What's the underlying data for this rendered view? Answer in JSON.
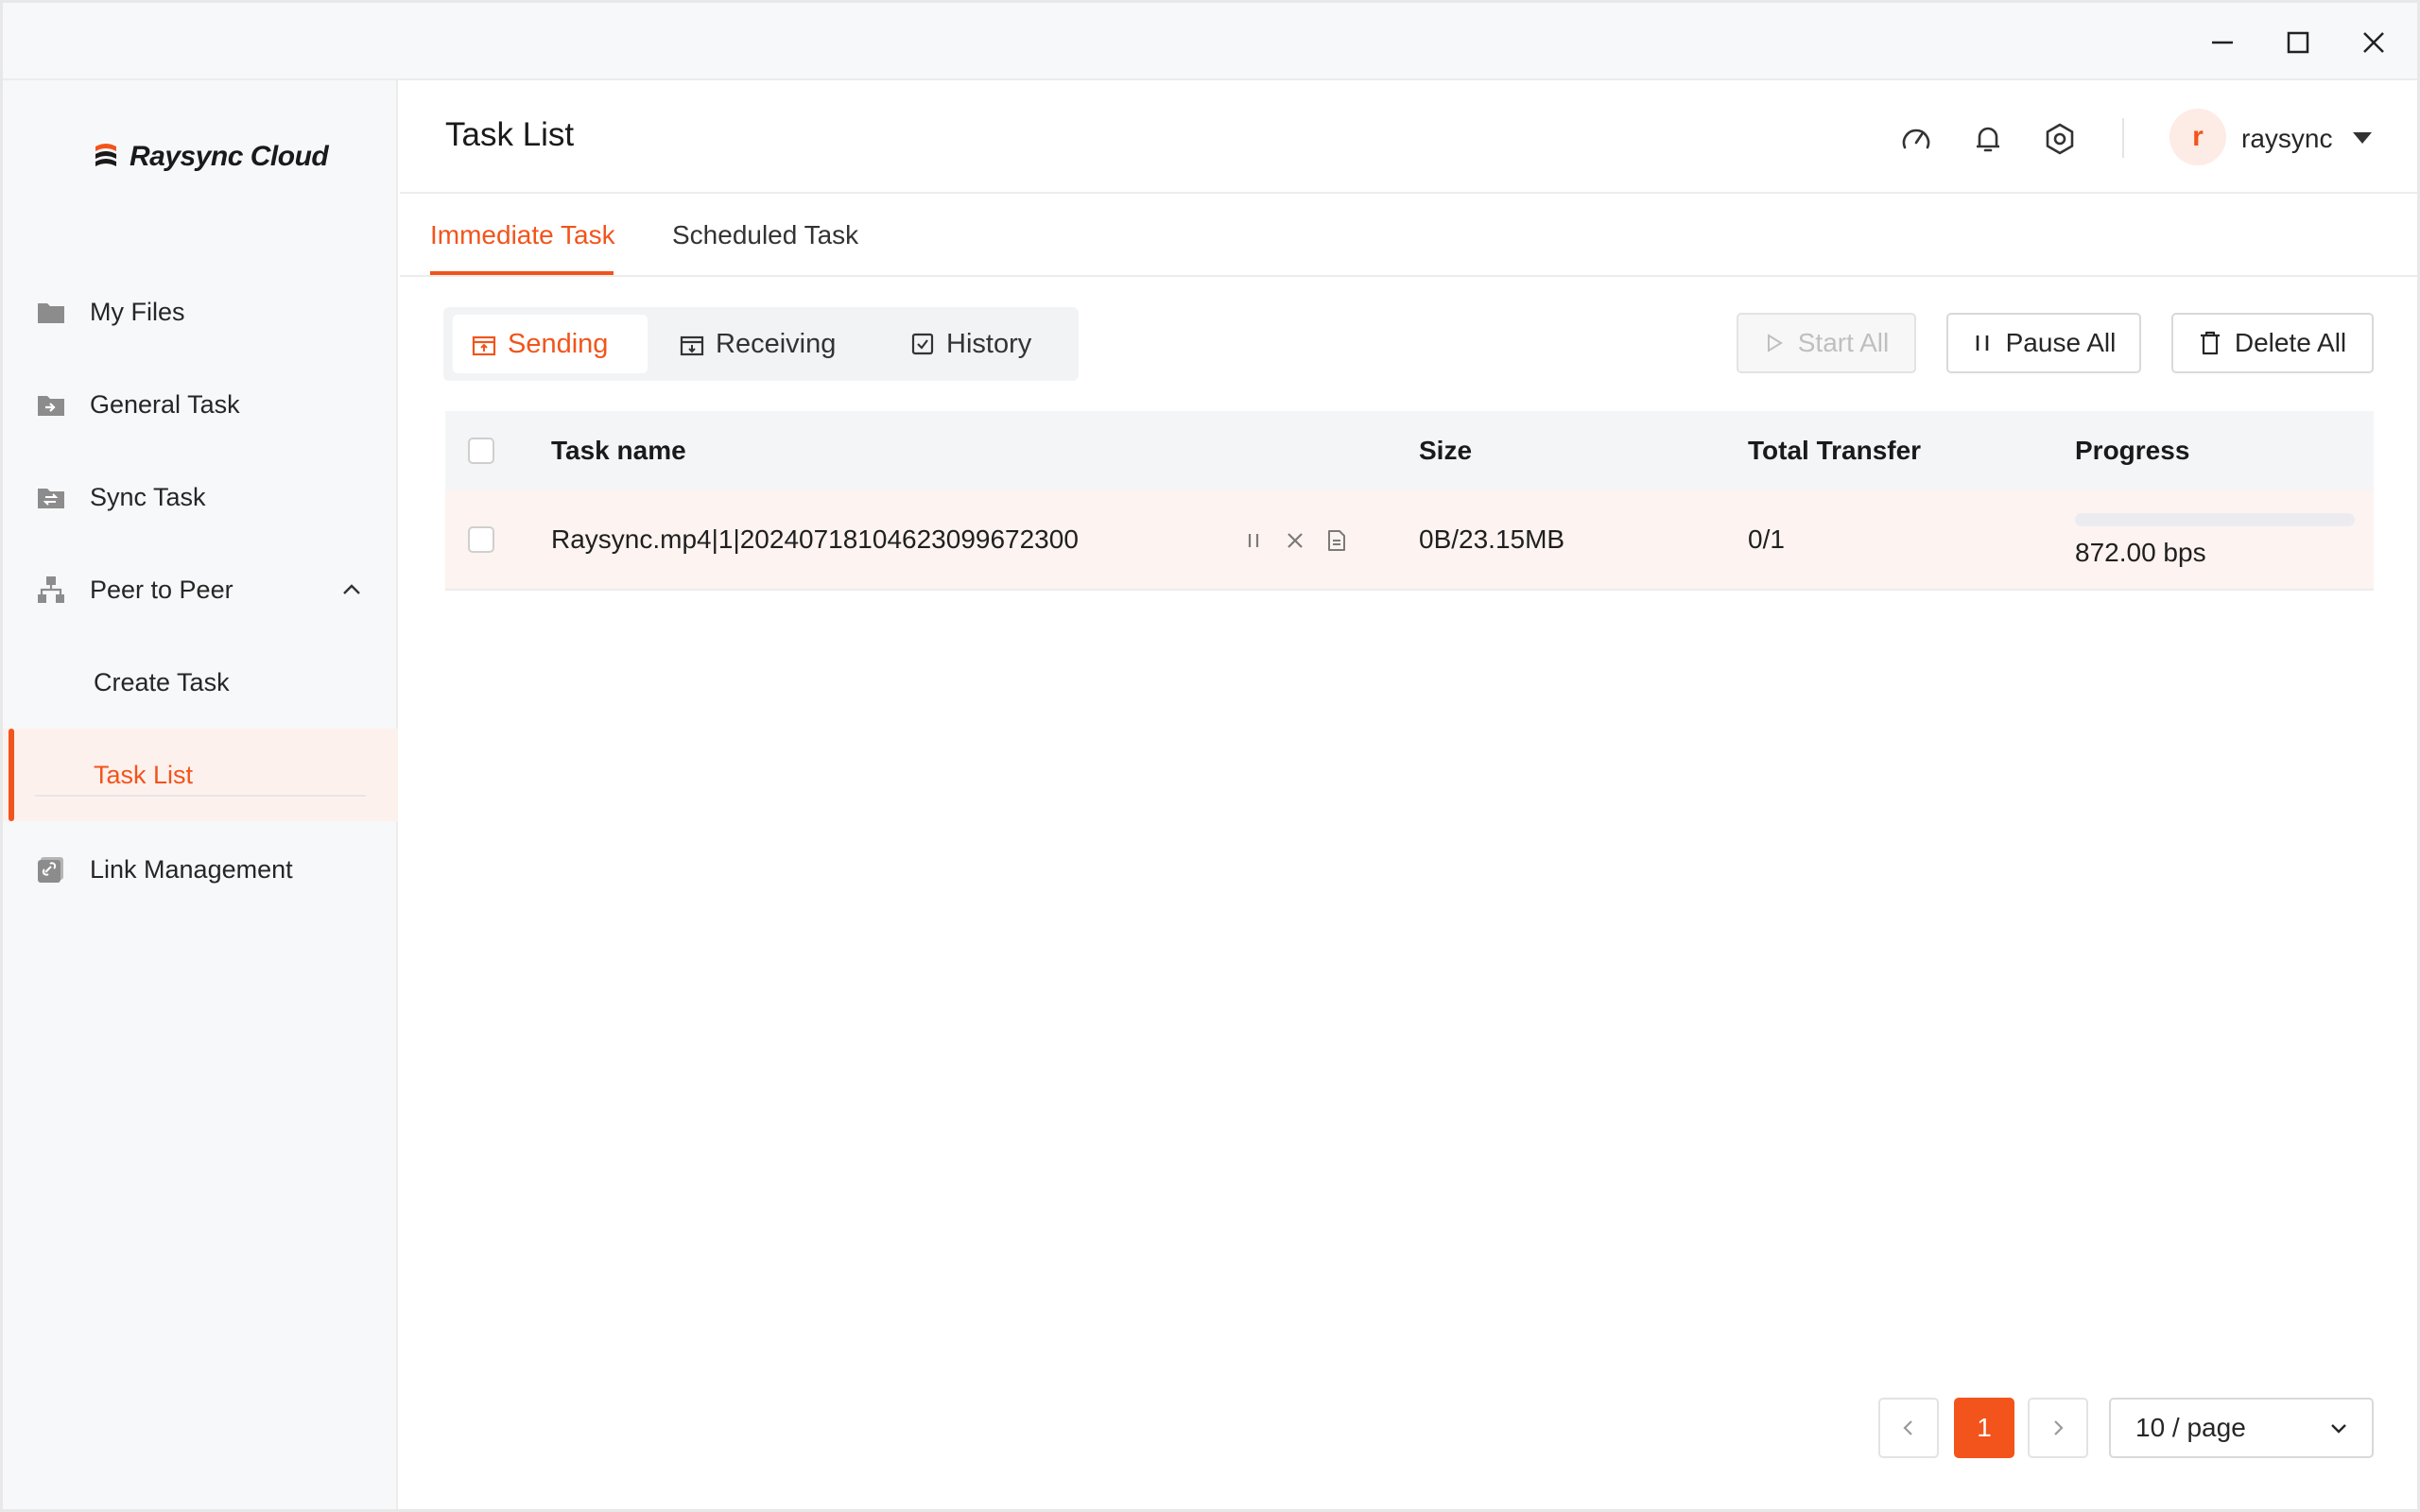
{
  "app": {
    "logo_text": "Raysync Cloud",
    "window_controls": [
      "minimize-icon",
      "maximize-icon",
      "close-icon"
    ]
  },
  "sidebar": {
    "items": [
      {
        "label": "My Files",
        "icon": "folder-icon"
      },
      {
        "label": "General Task",
        "icon": "folder-arrow-icon"
      },
      {
        "label": "Sync Task",
        "icon": "folder-sync-icon"
      },
      {
        "label": "Peer to Peer",
        "icon": "network-icon",
        "expanded": true
      },
      {
        "label": "Create Task"
      },
      {
        "label": "Task List",
        "active": true
      },
      {
        "label": "Link Management",
        "icon": "link-folder-icon"
      }
    ]
  },
  "header": {
    "title": "Task List",
    "icons": [
      "speed-icon",
      "bell-icon",
      "settings-icon"
    ],
    "avatar_letter": "r",
    "username": "raysync"
  },
  "tabs": [
    {
      "label": "Immediate Task",
      "active": true
    },
    {
      "label": "Scheduled Task",
      "active": false
    }
  ],
  "segments": [
    {
      "label": "Sending",
      "active": true
    },
    {
      "label": "Receiving",
      "active": false
    },
    {
      "label": "History",
      "active": false
    }
  ],
  "actions": {
    "start_all": "Start All",
    "pause_all": "Pause All",
    "delete_all": "Delete All"
  },
  "table": {
    "columns": [
      "Task name",
      "Size",
      "Total Transfer",
      "Progress"
    ],
    "rows": [
      {
        "task_name": "Raysync.mp4|1|20240718104623099672300",
        "size": "0B/23.15MB",
        "total_transfer": "0/1",
        "progress_fraction": 0,
        "speed": "872.00 bps"
      }
    ]
  },
  "pagination": {
    "current_page": "1",
    "page_size": "10 / page"
  },
  "colors": {
    "accent": "#f2541b",
    "active_bg": "#fdf1ee",
    "row_bg": "#fdf3f0"
  }
}
